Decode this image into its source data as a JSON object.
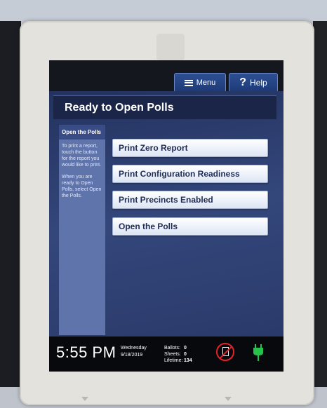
{
  "header": {
    "menu_label": "Menu",
    "help_label": "Help",
    "help_icon": "question-mark"
  },
  "page": {
    "title": "Ready to Open Polls"
  },
  "sidebar": {
    "heading": "Open the Polls",
    "instructions": [
      "To print a report, touch the button for the report you would like to print.",
      "When you are ready to Open Polls, select Open the Polls."
    ]
  },
  "actions": [
    {
      "label": "Print Zero Report"
    },
    {
      "label": "Print Configuration Readiness"
    },
    {
      "label": "Print Precincts Enabled"
    },
    {
      "label": "Open the Polls"
    }
  ],
  "status": {
    "time": "5:55 PM",
    "day": "Wednesday",
    "date": "9/18/2019",
    "ballots_label": "Ballots:",
    "ballots_value": "0",
    "sheets_label": "Sheets:",
    "sheets_value": "0",
    "lifetime_label": "Lifetime:",
    "lifetime_value": "134",
    "paper_icon": "no-paper-icon",
    "power_icon": "plug-icon"
  },
  "colors": {
    "screen_bg": "#34477b",
    "title_bar": "#1b2547",
    "button_bg": "#ffffff",
    "button_text": "#1f2d55",
    "status_red": "#e0242a",
    "power_green": "#27c24c"
  }
}
